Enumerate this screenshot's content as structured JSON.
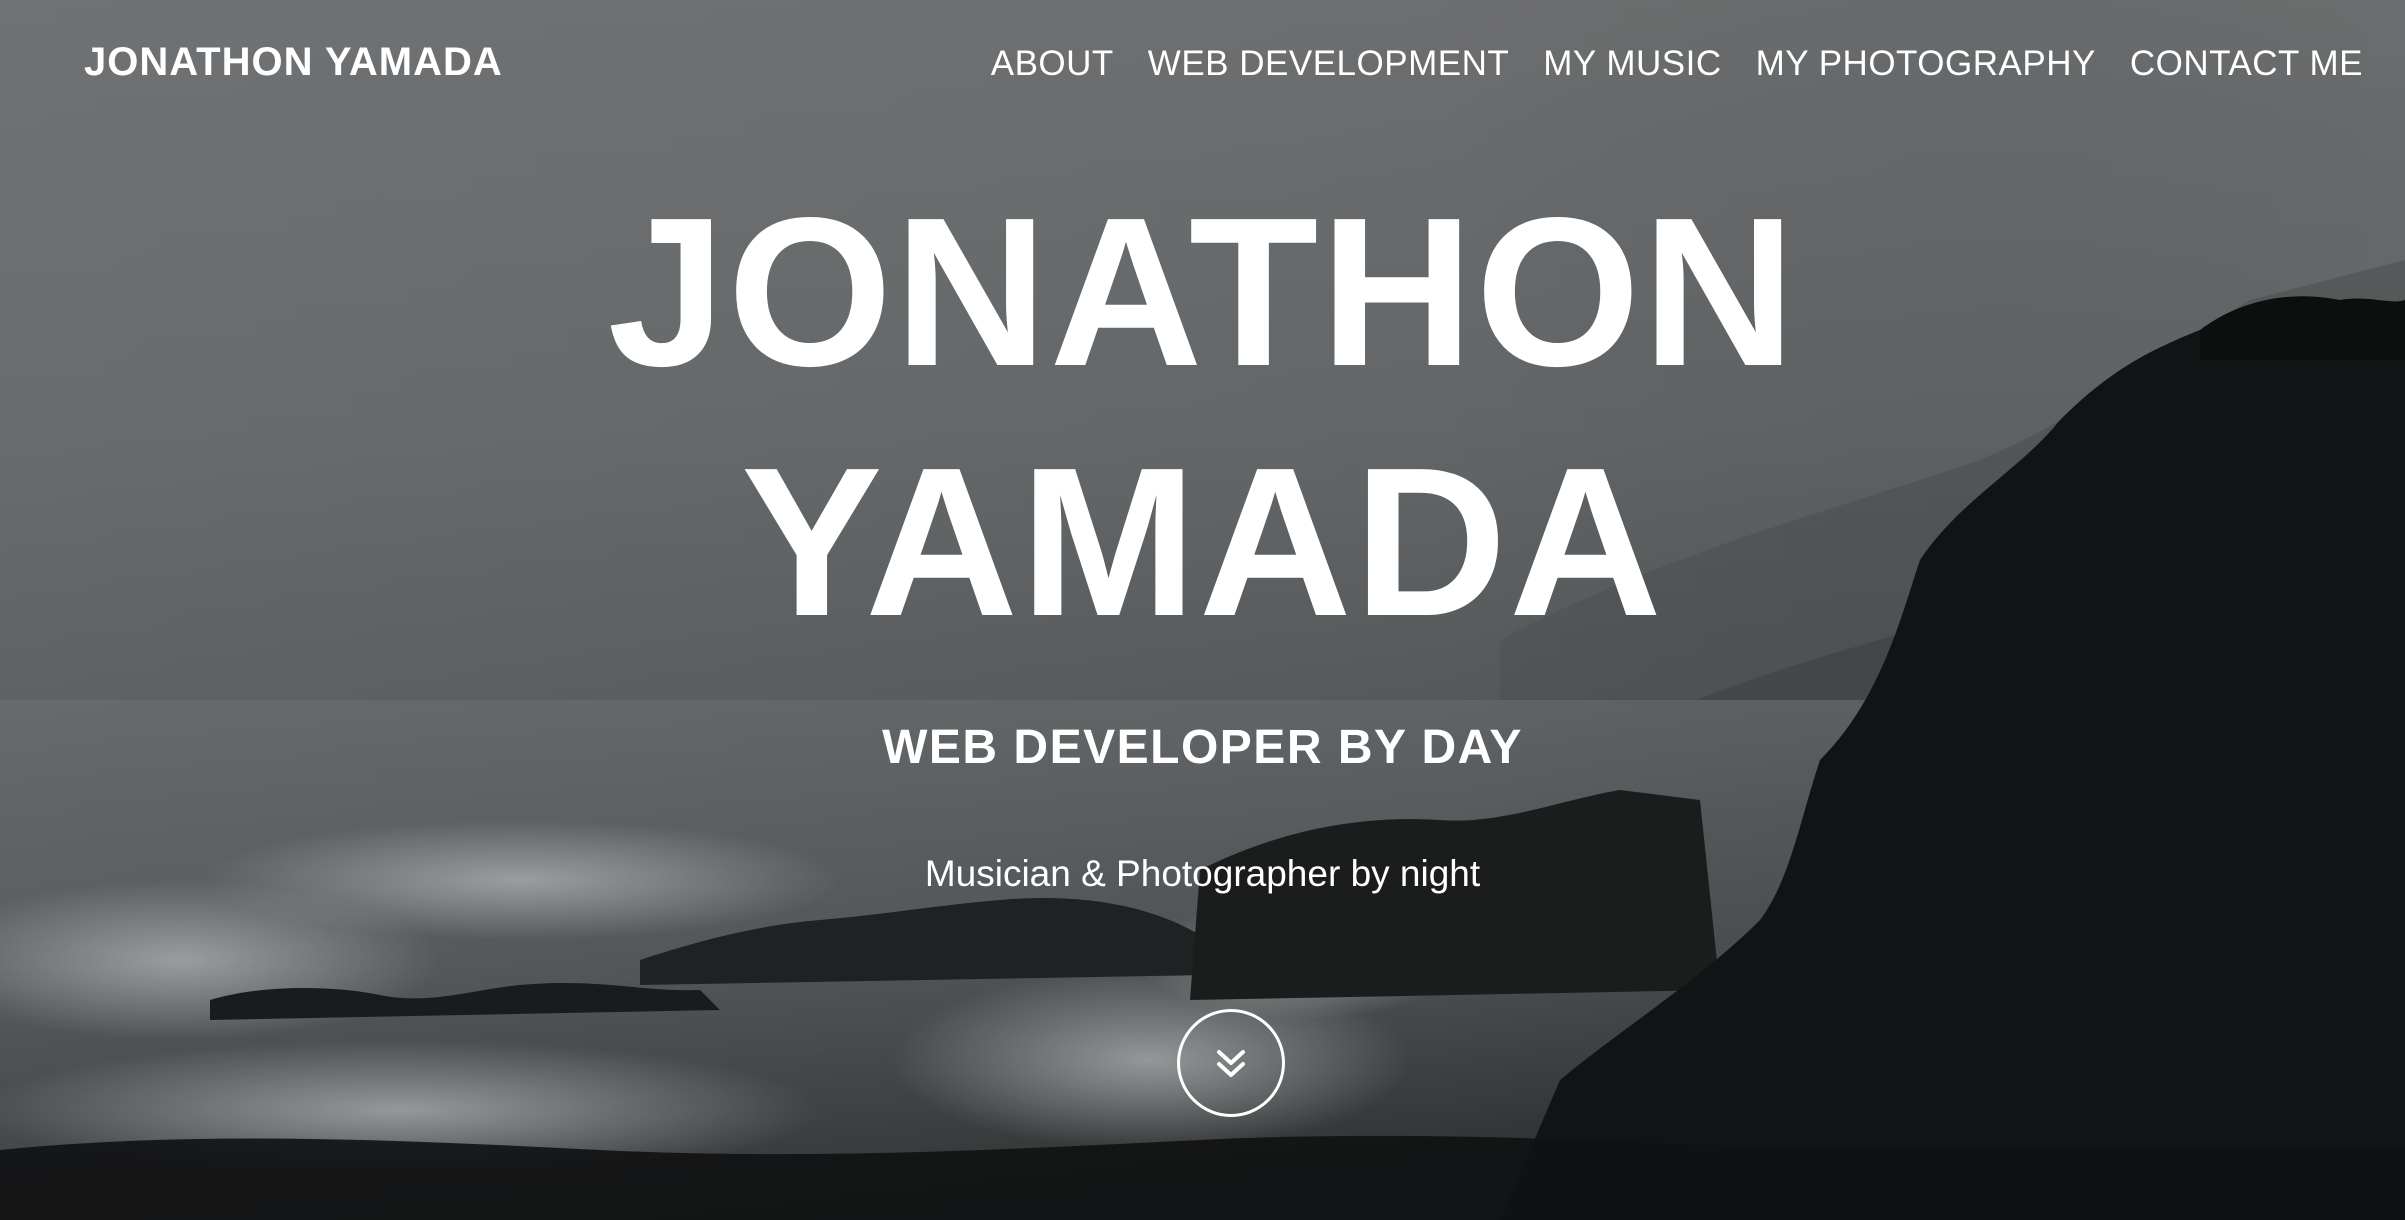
{
  "nav": {
    "brand": "JONATHON YAMADA",
    "links": [
      {
        "label": "ABOUT"
      },
      {
        "label": "WEB DEVELOPMENT"
      },
      {
        "label": "MY MUSIC"
      },
      {
        "label": "MY PHOTOGRAPHY"
      },
      {
        "label": "CONTACT ME"
      }
    ]
  },
  "hero": {
    "title_line1": "JONATHON",
    "title_line2": "YAMADA",
    "tagline": "WEB DEVELOPER BY DAY",
    "subtagline": "Musician & Photographer by night",
    "scroll_icon": "double-chevron-down-icon",
    "background": "grayscale rocky coastline with crashing waves"
  },
  "colors": {
    "text": "#ffffff",
    "overlay_top": "#6f7375",
    "overlay_bottom": "#151617"
  }
}
